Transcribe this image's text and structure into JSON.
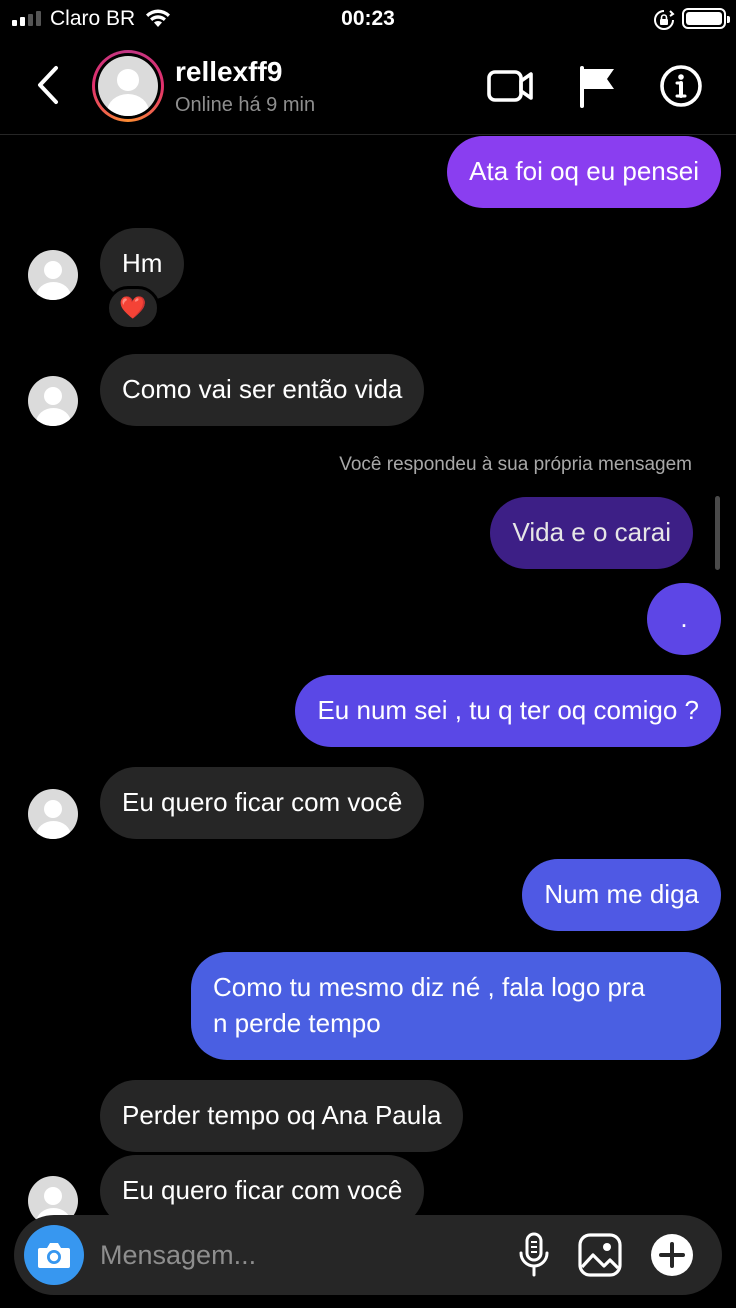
{
  "status_bar": {
    "carrier": "Claro BR",
    "time": "00:23"
  },
  "header": {
    "username": "rellexff9",
    "presence": "Online há 9 min"
  },
  "messages": [
    {
      "side": "out",
      "text": "Ata foi oq eu pensei",
      "color": "#8a3ef0"
    },
    {
      "side": "in",
      "text": "Hm",
      "reaction": "❤️"
    },
    {
      "side": "in",
      "text": "Como vai ser então vida"
    },
    {
      "side": "note",
      "text": "Você respondeu à sua própria mensagem"
    },
    {
      "side": "out",
      "text": "Vida e o carai",
      "color": "#3d1f86"
    },
    {
      "side": "out",
      "text": ".",
      "color": "#5d46e6"
    },
    {
      "side": "out",
      "text": "Eu num sei , tu q ter oq comigo ?",
      "color": "#5a48e6"
    },
    {
      "side": "in",
      "text": "Eu quero ficar com você"
    },
    {
      "side": "out",
      "text": "Num me diga",
      "color": "#4f59e4"
    },
    {
      "side": "out",
      "text_line1": "Como tu mesmo diz né , fala logo pra",
      "text_line2": "n perde tempo",
      "color": "#4a5fe2"
    },
    {
      "side": "in",
      "text": "Perder tempo oq Ana Paula"
    },
    {
      "side": "in",
      "text": "Eu quero ficar com você"
    }
  ],
  "composer": {
    "placeholder": "Mensagem...",
    "accent": "#3797f0"
  },
  "icons": [
    "signal-icon",
    "wifi-icon",
    "rotation-lock-icon",
    "battery-icon",
    "back-icon",
    "video-call-icon",
    "flag-icon",
    "info-icon",
    "camera-icon",
    "microphone-icon",
    "gallery-icon",
    "plus-icon"
  ]
}
